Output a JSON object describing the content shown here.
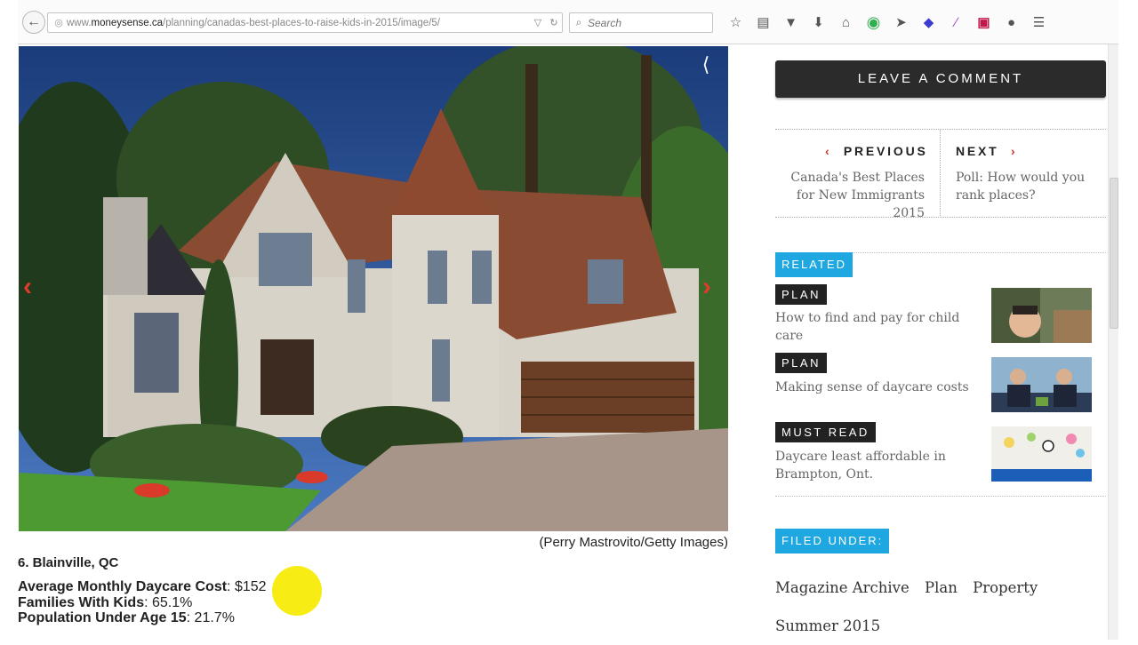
{
  "browser": {
    "url_prefix": "www.",
    "url_domain": "moneysense.ca",
    "url_path": "/planning/canadas-best-places-to-raise-kids-in-2015/image/5/",
    "search_placeholder": "Search"
  },
  "article": {
    "photo_credit": "(Perry Mastrovito/Getty Images)",
    "city_title": "6. Blainville, QC",
    "stats": [
      {
        "label": "Average Monthly Daycare Cost",
        "value": ": $152"
      },
      {
        "label": "Families With Kids",
        "value": ": 65.1%"
      },
      {
        "label": "Population Under Age 15",
        "value": ": 21.7%"
      }
    ]
  },
  "sidebar": {
    "leave_comment": "LEAVE A COMMENT",
    "previous_label": "PREVIOUS",
    "next_label": "NEXT",
    "previous_title": "Canada's Best Places for New Immigrants 2015",
    "next_title": "Poll: How would you rank places?",
    "related_label": "RELATED",
    "related": [
      {
        "category": "PLAN",
        "title": "How to find and pay for child care"
      },
      {
        "category": "PLAN",
        "title": "Making sense of daycare costs"
      },
      {
        "category": "MUST READ",
        "title": "Daycare least affordable in Brampton, Ont."
      }
    ],
    "filed_under_label": "FILED UNDER:",
    "tags": [
      "Magazine Archive",
      "Plan",
      "Property",
      "Summer 2015"
    ]
  },
  "colors": {
    "accent_blue": "#1ea7e1",
    "arrow_red": "#e23a2f",
    "highlight_yellow": "#f6ec00"
  }
}
